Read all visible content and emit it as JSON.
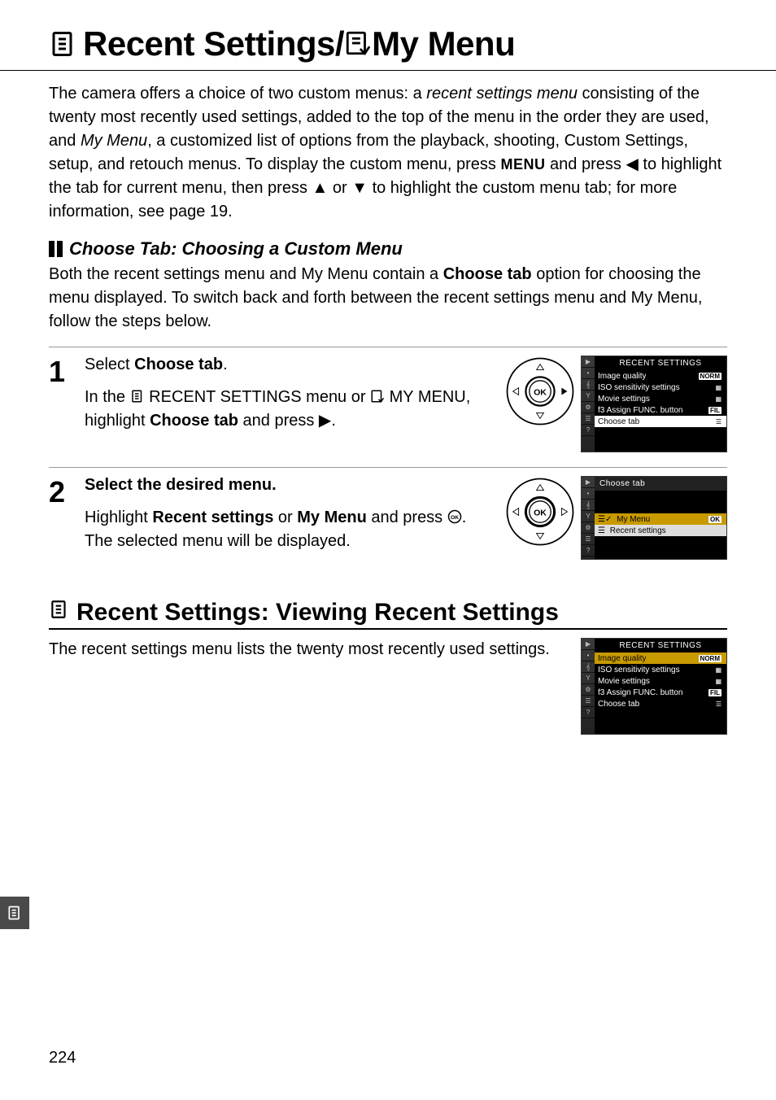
{
  "title": {
    "pre": "Recent Settings/",
    "post": "My Menu"
  },
  "intro": {
    "p1a": "The camera offers a choice of two custom menus: a ",
    "p1b_italic": "recent settings menu",
    "p1c": " consisting of the twenty most recently used settings, added to the top of the menu in the order they are used, and ",
    "p1d_italic": "My Menu",
    "p1e": ", a customized list of options from the playback, shooting, Custom Settings, setup, and retouch menus.  To display the custom menu, press ",
    "p1f_menu": "MENU",
    "p1g": " and press ",
    "p1h": " to highlight the tab for current menu, then press ",
    "p1i": " or ",
    "p1j": " to highlight the custom menu tab; for more information, see page 19."
  },
  "subhead": "Choose Tab: Choosing a Custom Menu",
  "subbody": {
    "a": "Both the recent settings menu and My Menu contain a ",
    "b_bold": "Choose tab",
    "c": " option for choosing the menu displayed.  To switch back and forth between the recent settings menu and My Menu, follow the steps below."
  },
  "steps": [
    {
      "num": "1",
      "title_a": "Select ",
      "title_b_bold": "Choose tab",
      "title_c": ".",
      "body_a": "In the ",
      "body_b": " RECENT SETTINGS menu or ",
      "body_c": " MY MENU, highlight ",
      "body_d_bold": "Choose tab",
      "body_e": " and press ",
      "body_f": "."
    },
    {
      "num": "2",
      "title_a": "Select the desired menu.",
      "body_a": "Highlight ",
      "body_b_bold": "Recent settings",
      "body_c": " or ",
      "body_d_bold": "My Menu",
      "body_e": " and press ",
      "body_f": ".  The selected menu will be displayed."
    }
  ],
  "lcd1": {
    "title": "RECENT SETTINGS",
    "rows": [
      {
        "label": "Image quality",
        "val": "NORM",
        "cls": ""
      },
      {
        "label": "ISO sensitivity settings",
        "val": "▦",
        "cls": ""
      },
      {
        "label": "Movie settings",
        "val": "▦",
        "cls": ""
      },
      {
        "label": "f3 Assign FUNC. button",
        "val": "FIL",
        "cls": ""
      },
      {
        "label": "Choose tab",
        "val": "☰",
        "cls": "sel"
      }
    ],
    "side": [
      "▶",
      "•",
      "𝄞",
      "Y",
      "⚙",
      "☰",
      "?"
    ]
  },
  "lcd2": {
    "title": "Choose tab",
    "rows": [
      {
        "label": "My Menu",
        "val": "OK",
        "cls": "hl",
        "icon": "my"
      },
      {
        "label": "Recent settings",
        "val": "",
        "cls": "sel2",
        "icon": "rs"
      }
    ],
    "side": [
      "▶",
      "•",
      "𝄞",
      "Y",
      "⚙",
      "☰",
      "?"
    ]
  },
  "section2": {
    "title": "Recent Settings: Viewing Recent Settings",
    "body": "The recent settings menu lists the twenty most recently used settings."
  },
  "lcd3": {
    "title": "RECENT SETTINGS",
    "rows": [
      {
        "label": "Image quality",
        "val": "NORM",
        "cls": "hl"
      },
      {
        "label": "ISO sensitivity settings",
        "val": "▦",
        "cls": ""
      },
      {
        "label": "Movie settings",
        "val": "▦",
        "cls": ""
      },
      {
        "label": "f3 Assign FUNC. button",
        "val": "FIL",
        "cls": ""
      },
      {
        "label": "Choose tab",
        "val": "☰",
        "cls": ""
      }
    ],
    "side": [
      "▶",
      "•",
      "𝄞",
      "Y",
      "⚙",
      "☰",
      "?"
    ]
  },
  "pageNumber": "224"
}
